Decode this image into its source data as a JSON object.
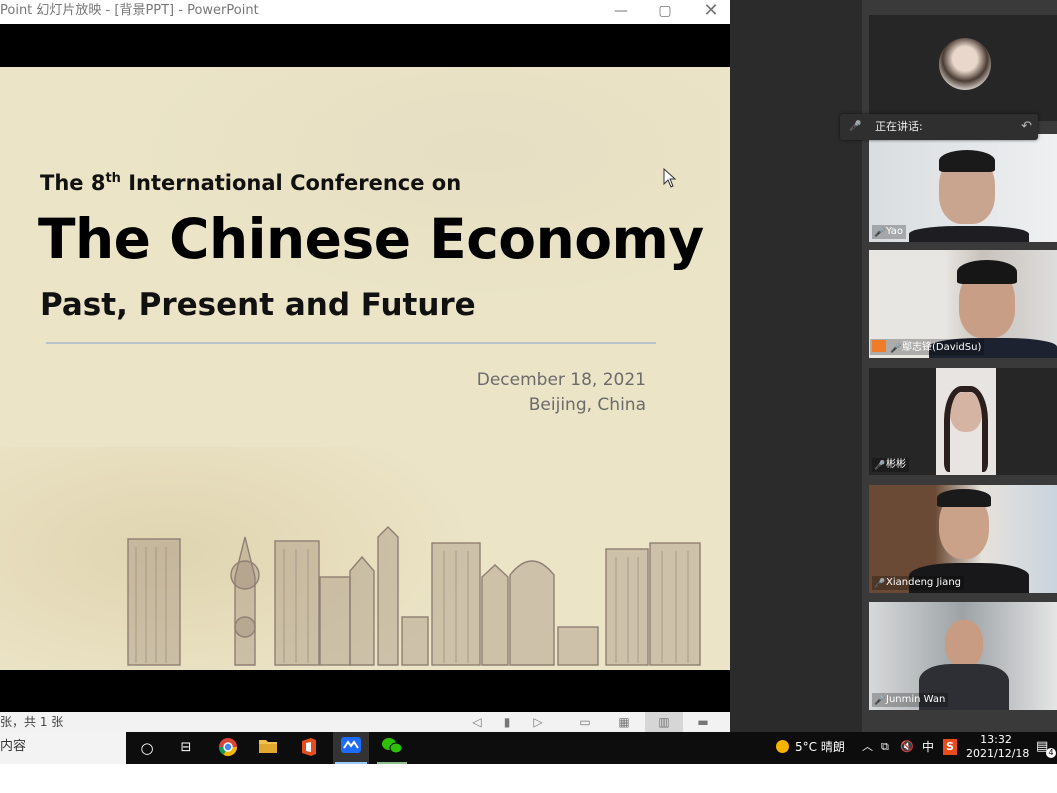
{
  "window": {
    "title": "Point 幻灯片放映 - [背景PPT] - PowerPoint",
    "minimize": "—",
    "maximize": "▢",
    "close": "✕"
  },
  "slide": {
    "conference_prefix": "The 8",
    "conference_sup": "th",
    "conference_suffix": " International Conference on",
    "main_title": "The Chinese Economy",
    "subtitle": "Past, Present and Future",
    "date": "December 18, 2021",
    "place": "Beijing, China"
  },
  "statusbar": {
    "slide_count": "张，共 1 张"
  },
  "meeting": {
    "speaking_label": "正在讲话:",
    "participants": [
      {
        "name": ""
      },
      {
        "name": "Yao"
      },
      {
        "name": "鄢志锋(DavidSu)"
      },
      {
        "name": "彬彬"
      },
      {
        "name": "Xiandeng Jiang"
      },
      {
        "name": "Junmin Wan"
      }
    ]
  },
  "taskbar": {
    "search_text": "内容",
    "weather": "5°C  晴朗",
    "ime": "中",
    "time": "13:32",
    "date": "2021/12/18",
    "notification_count": "4"
  }
}
